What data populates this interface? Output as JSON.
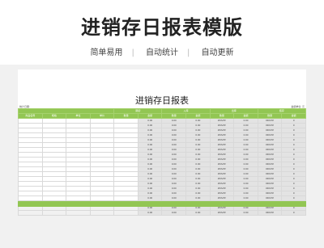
{
  "banner": {
    "title": "进销存日报表模版",
    "features": [
      "简单易用",
      "自动统计",
      "自动更新"
    ]
  },
  "sheet": {
    "title": "进销存日报表",
    "meta_left": "统计日期:",
    "meta_right": "金额单位: 元",
    "header_top": [
      "期初",
      "入库",
      "出库",
      "结存"
    ],
    "header_cols": [
      "商品名称",
      "规格",
      "单位",
      "单价",
      "数量",
      "金额",
      "数量",
      "金额",
      "数量",
      "金额",
      "数量",
      "金额"
    ],
    "rows": [
      [
        "0.00",
        "0.00",
        "0.00",
        "#DIV/0!",
        "0.00",
        "#DIV/0!",
        "0"
      ],
      [
        "0.00",
        "0.00",
        "0.00",
        "#DIV/0!",
        "0.00",
        "#DIV/0!",
        "0"
      ],
      [
        "0.00",
        "0.00",
        "0.00",
        "#DIV/0!",
        "0.00",
        "#DIV/0!",
        "0"
      ],
      [
        "0.00",
        "0.00",
        "0.00",
        "#DIV/0!",
        "0.00",
        "#DIV/0!",
        "0"
      ],
      [
        "0.00",
        "0.00",
        "0.00",
        "#DIV/0!",
        "0.00",
        "#DIV/0!",
        "0"
      ],
      [
        "0.00",
        "0.00",
        "0.00",
        "#DIV/0!",
        "0.00",
        "#DIV/0!",
        "0"
      ],
      [
        "0.00",
        "0.00",
        "0.00",
        "#DIV/0!",
        "0.00",
        "#DIV/0!",
        "0"
      ],
      [
        "0.00",
        "0.00",
        "0.00",
        "#DIV/0!",
        "0.00",
        "#DIV/0!",
        "0"
      ],
      [
        "0.00",
        "0.00",
        "0.00",
        "#DIV/0!",
        "0.00",
        "#DIV/0!",
        "0"
      ],
      [
        "0.00",
        "0.00",
        "0.00",
        "#DIV/0!",
        "0.00",
        "#DIV/0!",
        "0"
      ],
      [
        "0.00",
        "0.00",
        "0.00",
        "#DIV/0!",
        "0.00",
        "#DIV/0!",
        "0"
      ],
      [
        "0.00",
        "0.00",
        "0.00",
        "#DIV/0!",
        "0.00",
        "#DIV/0!",
        "0"
      ],
      [
        "0.00",
        "0.00",
        "0.00",
        "#DIV/0!",
        "0.00",
        "#DIV/0!",
        "0"
      ],
      [
        "0.00",
        "0.00",
        "0.00",
        "#DIV/0!",
        "0.00",
        "#DIV/0!",
        "0"
      ],
      [
        "0.00",
        "0.00",
        "0.00",
        "#DIV/0!",
        "0.00",
        "#DIV/0!",
        "0"
      ],
      [
        "0.00",
        "0.00",
        "0.00",
        "#DIV/0!",
        "0.00",
        "#DIV/0!",
        "0"
      ],
      [
        "0.00",
        "0.00",
        "0.00",
        "#DIV/0!",
        "0.00",
        "#DIV/0!",
        "0"
      ],
      [
        "0.00",
        "0.00",
        "0.00",
        "#DIV/0!",
        "0.00",
        "#DIV/0!",
        "0"
      ],
      [
        "0.00",
        "0.00",
        "0.00",
        "#DIV/0!",
        "0.00",
        "#DIV/0!",
        "0"
      ],
      [
        "0.00",
        "0.00",
        "0.00",
        "#DIV/0!",
        "0.00",
        "#DIV/0!",
        "0"
      ]
    ]
  },
  "colors": {
    "header_green": "#92c653",
    "formula_gray": "#e3e3e3",
    "panel_bg": "#f1f1f1"
  }
}
